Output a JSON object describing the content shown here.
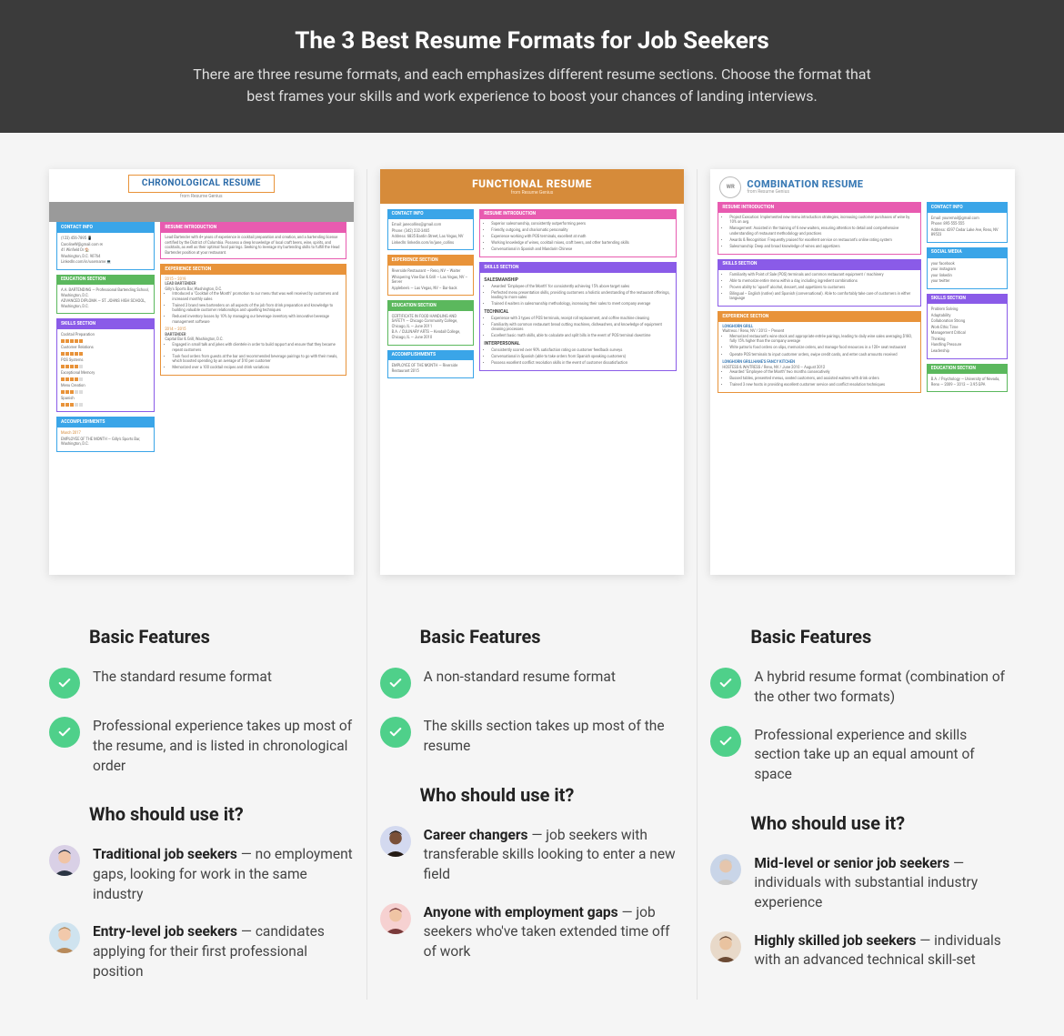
{
  "header": {
    "title": "The 3 Best Resume Formats for Job Seekers",
    "subtitle": "There are three resume formats, and each emphasizes different resume sections. Choose the format that best frames your skills and work experience to boost your chances of landing interviews."
  },
  "columns": [
    {
      "thumb": {
        "kind": "chronological",
        "title": "CHRONOLOGICAL RESUME",
        "sub": "from Resume Genius",
        "sections": {
          "contact": {
            "label": "CONTACT INFO",
            "body": [
              "(123) 456-7895  📱",
              "CarolineW@gmail.com  ✉",
              "41 Winfield Dr  🏠",
              "Washington, D.C. 90764",
              "LinkedIn.com/in/username  💻"
            ]
          },
          "resume_intro": {
            "label": "RESUME INTRODUCTION",
            "body": "Lead Bartender with 4+ years of experience in cocktail preparation and creation, and a bartending license certified by the District of Columbia. Possess a deep knowledge of local craft beers, wine, spirits, and cocktails, as well as their optimal food pairings. Seeking to leverage my bartending skills to fulfill the Head Bartender position at your restaurant."
          },
          "education": {
            "label": "EDUCATION SECTION",
            "body": [
              "A.A. BARTENDING — Professional Bartending School, Washington, D.C.",
              "ADVANCED DIPLOMA — ST. JOHNS HIGH SCHOOL, Washington, D.C."
            ]
          },
          "skills": {
            "label": "SKILLS SECTION",
            "items": [
              "Cocktail Preparation",
              "Customer Relations",
              "POS Systems",
              "Exceptional Memory",
              "Menu Creation",
              "Spanish"
            ]
          },
          "accomplishments": {
            "label": "ACCOMPLISHMENTS",
            "body": [
              "March 2017",
              "EMPLOYEE OF THE MONTH — Gilly's Sports Bar, Washington, D.C."
            ]
          },
          "experience": {
            "label": "EXPERIENCE SECTION",
            "jobs": [
              {
                "dates": "2015 – 2019",
                "title": "LEAD BARTENDER",
                "place": "Gilly's Sports Bar, Washington, D.C.",
                "bullets": [
                  "Introduced a \"Cocktail of the Month\" promotion to our menu that was well received by customers and increased monthly sales",
                  "Trained 3 brand new bartenders on all aspects of the job from drink preparation and knowledge to building valuable customer relationships and upselling techniques",
                  "Reduced inventory losses by 10% by managing our beverage inventory with innovative beverage management software"
                ]
              },
              {
                "dates": "2014 – 2015",
                "title": "BARTENDER",
                "place": "Capital Bar & Grill, Washington, D.C.",
                "bullets": [
                  "Engaged in small talk and jokes with clientele in order to build rapport and ensure that they became repeat customers",
                  "Took food orders from guests at the bar and recommended beverage pairings to go with their meals, which boosted spending by an average of $10 per customer",
                  "Memorized over a 100 cocktail recipes and drink variations"
                ]
              }
            ]
          }
        }
      },
      "features_heading": "Basic Features",
      "features": [
        "The standard resume format",
        "Professional experience takes up most of the resume, and is listed in chronological order"
      ],
      "who_heading": "Who should use it?",
      "who": [
        {
          "bold": "Traditional job seekers",
          "rest": " — no employment gaps, looking for work in the same industry",
          "avatar_bg": "#d9d0e6",
          "face": "#f0c4a6",
          "hair": "#2a3442"
        },
        {
          "bold": "Entry-level job seekers",
          "rest": " — candidates applying for their first professional position",
          "avatar_bg": "#cfe3ef",
          "face": "#f2c9ab",
          "hair": "#b88a5a"
        }
      ]
    },
    {
      "thumb": {
        "kind": "functional",
        "title": "FUNCTIONAL RESUME",
        "sub": "from Resume Genius",
        "sections": {
          "contact": {
            "label": "CONTACT INFO",
            "body": [
              "Email: janecollins@gmail.com",
              "Phone: (342) 232-3465",
              "Address: 6835 Bardin Street, Las Vegas, NV",
              "LinkedIn: linkedin.com/in/jane_collins"
            ]
          },
          "resume_intro": {
            "label": "RESUME INTRODUCTION",
            "bullets": [
              "Superior salesmanship, consistently outperforming peers",
              "Friendly, outgoing, and charismatic personality",
              "Experience working with POS terminals, excellent at math",
              "Working knowledge of wines, cocktail mixes, craft beers, and other bartending skills",
              "Conversational in Spanish and Mandarin Chinese"
            ]
          },
          "experience": {
            "label": "EXPERIENCE SECTION",
            "body": [
              "Riverside Restaurant — Reno, NV – Waiter",
              "Whispering Vine Bar & Grill — Las Vegas, NV – Server",
              "Applebee's — Las Vegas, NV – Bar-back"
            ]
          },
          "education": {
            "label": "EDUCATION SECTION",
            "body": [
              "CERTIFICATE IN FOOD HANDLING AND SAFETY — Chicago Community College, Chicago, IL — June 2011",
              "B.A. / CULINARY ARTS — Kendall College, Chicago, IL — June 2010"
            ]
          },
          "accomplishments": {
            "label": "ACCOMPLISHMENTS",
            "body": [
              "EMPLOYEE OF THE MONTH — Riverside Restaurant 2015"
            ]
          },
          "skills": {
            "label": "SKILLS SECTION",
            "groups": [
              {
                "title": "SALESMANSHIP",
                "bullets": [
                  "Awarded \"Employee of the Month\" for consistently achieving 15% above target sales",
                  "Perfected menu presentation skills, providing customers a holistic understanding of the restaurant offerings, leading to more sales",
                  "Trained 4 waiters in salesmanship methodology, increasing their sales to meet company average"
                ]
              },
              {
                "title": "TECHNICAL",
                "bullets": [
                  "Experience with 3 types of POS terminals, receipt roll replacement, and coffee machine cleaning",
                  "Familiarity with common restaurant bread cutting machines, dishwashers, and knowledge of equipment cleaning processes",
                  "Excellent basic math skills, able to calculate and split bills in the event of POS terminal downtime"
                ]
              },
              {
                "title": "INTERPERSONAL",
                "bullets": [
                  "Consistently scored over 90% satisfaction rating on customer feedback surveys",
                  "Conversational in Spanish (able to take orders from Spanish speaking customers)",
                  "Possess excellent conflict resolution skills in the event of customer dissatisfaction"
                ]
              }
            ]
          }
        }
      },
      "features_heading": "Basic Features",
      "features": [
        "A non-standard resume format",
        "The skills section takes up most of the resume"
      ],
      "who_heading": "Who should use it?",
      "who": [
        {
          "bold": "Career changers",
          "rest": " — job seekers with transferable skills looking to enter a new field",
          "avatar_bg": "#d3d9ef",
          "face": "#7a5038",
          "hair": "#241a14"
        },
        {
          "bold": "Anyone with employment gaps",
          "rest": " — job seekers who've taken extended time off of work",
          "avatar_bg": "#f6d1d1",
          "face": "#efc4a4",
          "hair": "#7a3a3a"
        }
      ]
    },
    {
      "thumb": {
        "kind": "combination",
        "title": "COMBINATION RESUME",
        "sub": "from Resume Genius",
        "avatar_initials": "WR",
        "sections": {
          "resume_intro": {
            "label": "RESUME INTRODUCTION",
            "bullets": [
              "Project Execution: Implemented new menu introduction strategies, increasing customer purchases of wine by 10% on avg.",
              "Management: Assisted in the training of 6 new waiters, ensuring attention to detail and comprehensive understanding of restaurant methodology and practices",
              "Awards & Recognition: Frequently praised for excellent service on restaurant's online rating system",
              "Salesmanship: Deep and broad knowledge of wines and appetizers"
            ]
          },
          "contact": {
            "label": "CONTACT INFO",
            "body": [
              "Email: youremail@gmail.com",
              "Phone: 895-555-555",
              "Address: 4397 Cedar Lake Ave, Reno, NV 89523"
            ]
          },
          "social": {
            "label": "SOCIAL MEDIA",
            "body": [
              "your facebook",
              "your instagram",
              "your linkedin",
              "your twitter"
            ]
          },
          "skills_list": {
            "label": "SKILLS SECTION",
            "items": [
              "Problem Solving",
              "Adaptability",
              "Collaboration Strong",
              "Work Ethic Time",
              "Management Critical",
              "Thinking",
              "Handling Pressure",
              "Leadership"
            ]
          },
          "education": {
            "label": "EDUCATION SECTION",
            "body": [
              "B.A. / Psychology — University of Nevada, Reno — 2009 – 2013 — 3.95 GPA"
            ]
          },
          "skills": {
            "label": "SKILLS SECTION",
            "bullets": [
              "Familiarity with Point of Sale (POS) terminals and common restaurant equipment / machinery",
              "Able to memorize entire menu within a day, including ingredient combinations",
              "Proven ability to \"upsell\" alcohol, dessert, and appetizers to customers",
              "Bilingual – English (native) and Spanish (conversational). Able to comfortably take care of customers in either language"
            ]
          },
          "experience": {
            "label": "EXPERIENCE SECTION",
            "jobs": [
              {
                "title": "LONGHORN GRILL",
                "meta": "Waitress / Reno, NV / 2013 – Present",
                "bullets": [
                  "Memorized restaurant's wine stock and appropriate entrée pairings, leading to daily wine sales averaging $180, fully 15% higher than the company average",
                  "Write patron's food orders on slips, memorize orders, and manage food resources in a 120+ seat restaurant",
                  "Operate POS terminals to input customer orders, swipe credit cards, and enter cash amounts received"
                ]
              },
              {
                "title": "LONGHORN GRILLHANE'S FANCY KITCHEN",
                "meta": "HOSTESS & WAITRESS / Reno, NV / June 2010 – August 2012",
                "bullets": [
                  "Awarded \"Employee of the Month\" two months consecutively",
                  "Bussed tables, presented menus, seated customers, and assisted waiters with drink orders",
                  "Trained 3 new hosts in providing excellent customer service and conflict resolution techniques"
                ]
              }
            ]
          }
        }
      },
      "features_heading": "Basic Features",
      "features": [
        "A hybrid resume format (combination of the other two formats)",
        "Professional experience and skills section take up an equal amount of space"
      ],
      "who_heading": "Who should use it?",
      "who": [
        {
          "bold": "Mid-level or senior job seekers",
          "rest": " — individuals with substantial industry experience",
          "avatar_bg": "#c9d5e8",
          "face": "#e5c6ad",
          "hair": "#c9c9c9"
        },
        {
          "bold": "Highly skilled job seekers",
          "rest": " — individuals with an advanced technical skill-set",
          "avatar_bg": "#e8d9c9",
          "face": "#e9c3a0",
          "hair": "#6b4a34"
        }
      ]
    }
  ]
}
